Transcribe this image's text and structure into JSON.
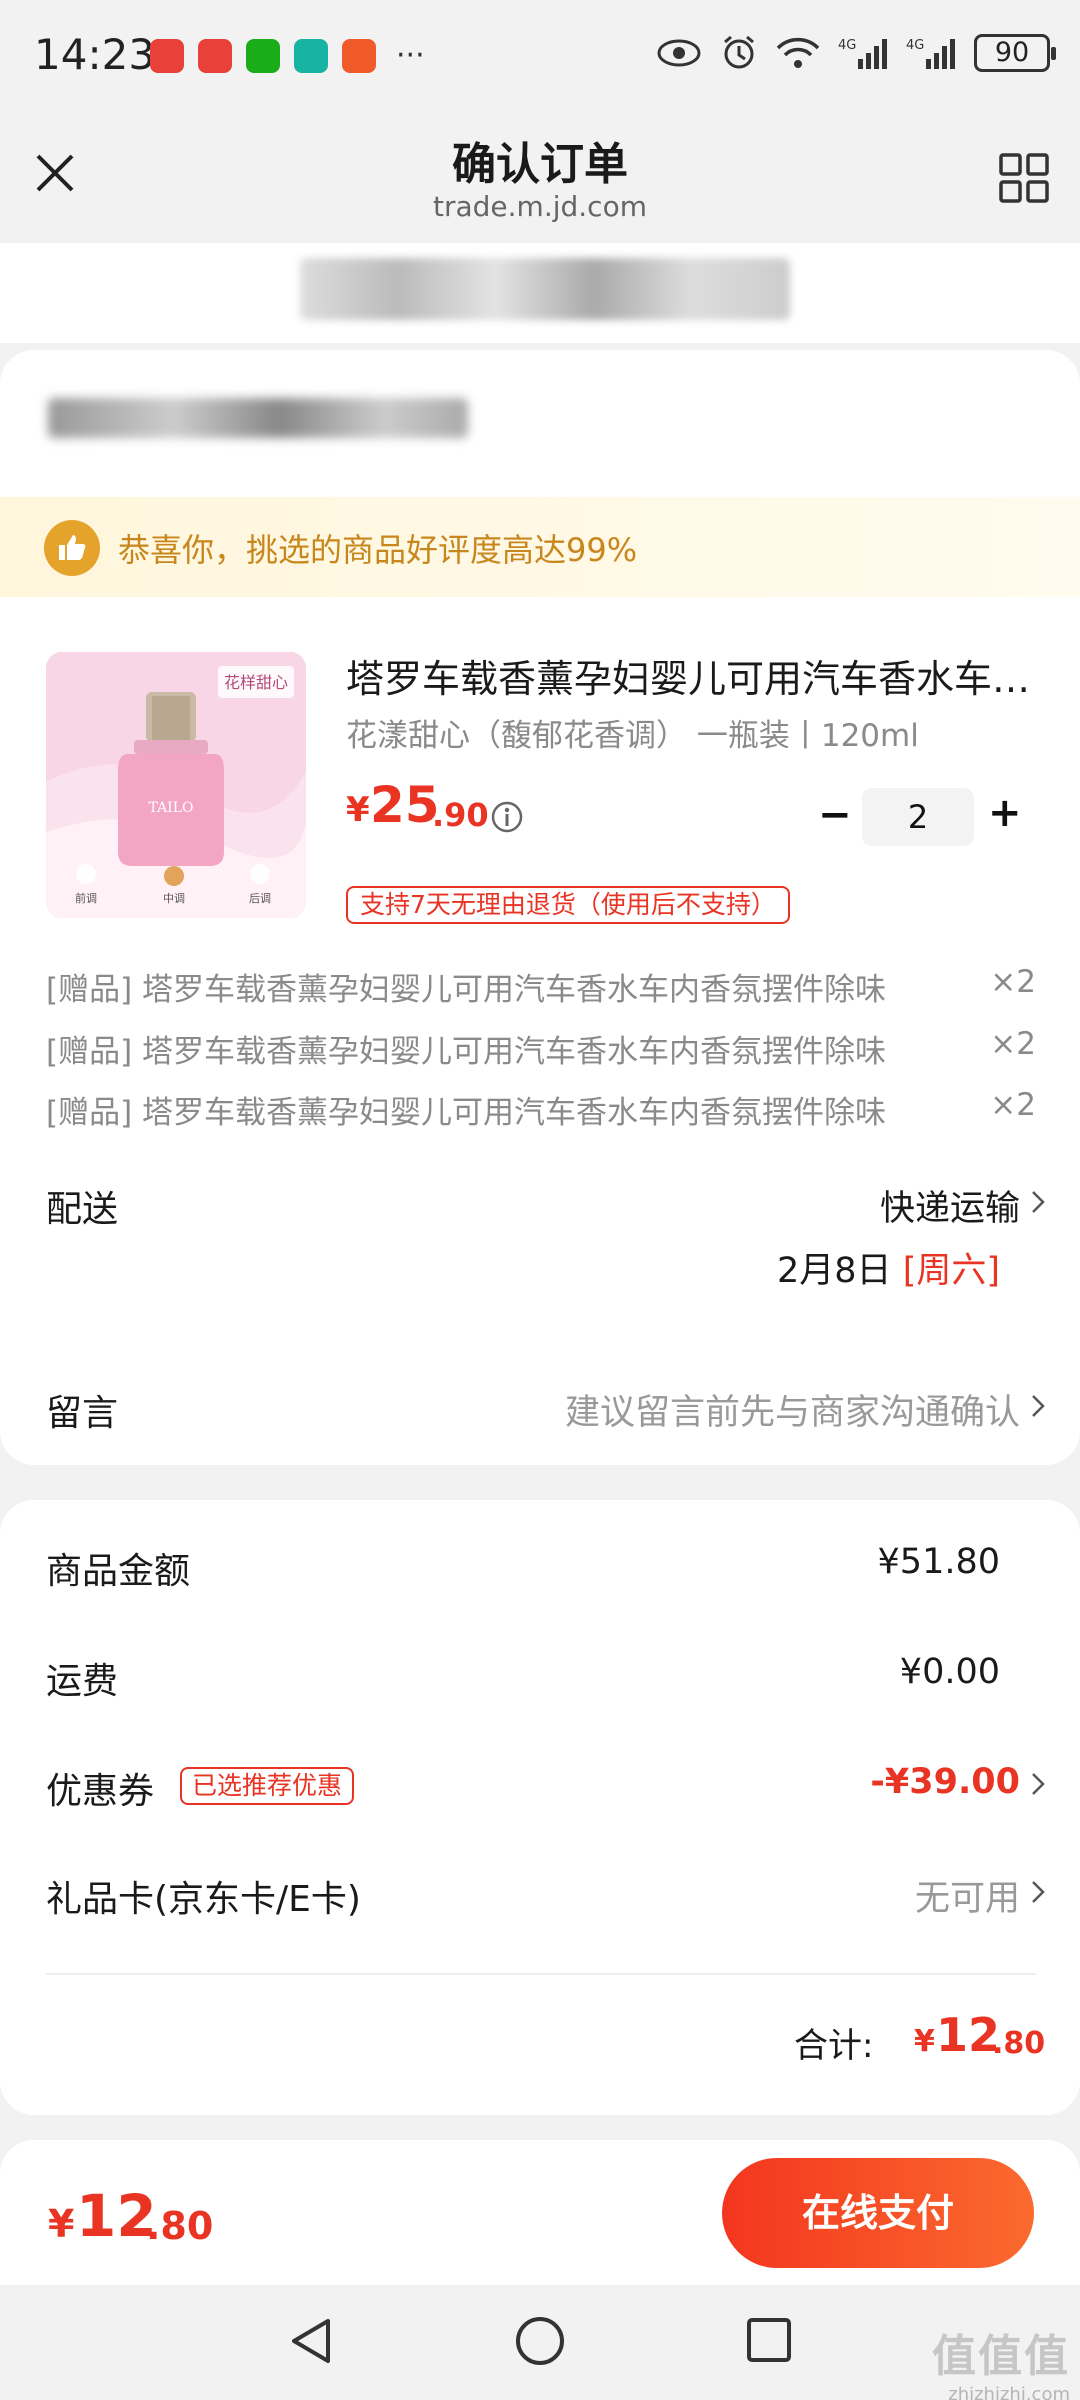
{
  "status_bar": {
    "time": "14:23",
    "app_icons": [
      {
        "name": "huawei-app-icon",
        "color": "#e8413a"
      },
      {
        "name": "huawei-store-icon",
        "color": "#e8413a"
      },
      {
        "name": "wechat-icon",
        "color": "#1aad19"
      },
      {
        "name": "mi-app-icon",
        "color": "#17b3a3"
      },
      {
        "name": "promo-app-icon",
        "color": "#f05a28"
      }
    ],
    "more": "···",
    "battery": "90"
  },
  "nav": {
    "title": "确认订单",
    "url": "trade.m.jd.com"
  },
  "banner": {
    "text": "恭喜你，挑选的商品好评度高达99%"
  },
  "product": {
    "title": "塔罗车载香薰孕妇婴儿可用汽车香水车内香氛摆件除味",
    "spec": "花漾甜心（馥郁花香调） 一瓶装丨120ml",
    "price_symbol": "¥",
    "price_int": "25",
    "price_dec": ".90",
    "quantity": "2",
    "minus": "−",
    "plus": "+",
    "return_policy": "支持7天无理由退货（使用后不支持）",
    "image": {
      "badge": "花样甜心",
      "brand": "TAILO",
      "notes": [
        "前调",
        "中调",
        "后调"
      ]
    }
  },
  "gifts": [
    {
      "text": "[赠品] 塔罗车载香薰孕妇婴儿可用汽车香水车内香氛摆件除味",
      "qty": "×2"
    },
    {
      "text": "[赠品] 塔罗车载香薰孕妇婴儿可用汽车香水车内香氛摆件除味",
      "qty": "×2"
    },
    {
      "text": "[赠品] 塔罗车载香薰孕妇婴儿可用汽车香水车内香氛摆件除味",
      "qty": "×2"
    }
  ],
  "delivery": {
    "label": "配送",
    "method": "快递运输",
    "date": "2月8日",
    "weekday": "[周六]"
  },
  "remark": {
    "label": "留言",
    "placeholder": "建议留言前先与商家沟通确认"
  },
  "summary": {
    "goods_label": "商品金额",
    "goods_value": "¥51.80",
    "shipping_label": "运费",
    "shipping_value": "¥0.00",
    "coupon_label": "优惠券",
    "coupon_badge": "已选推荐优惠",
    "coupon_value": "-¥39.00",
    "giftcard_label": "礼品卡(京东卡/E卡)",
    "giftcard_value": "无可用",
    "total_label": "合计:",
    "total_symbol": "¥",
    "total_int": "12",
    "total_dec": ".80"
  },
  "pay_bar": {
    "symbol": "¥",
    "int": "12",
    "dec": ".80",
    "button": "在线支付"
  },
  "watermark": {
    "big": "值值值",
    "small": "zhizhizhi.com"
  },
  "colors": {
    "accent_red": "#e93323",
    "banner_gold": "#c8871d",
    "pay_gradient_start": "#f3361f",
    "pay_gradient_end": "#fb6a2e"
  }
}
